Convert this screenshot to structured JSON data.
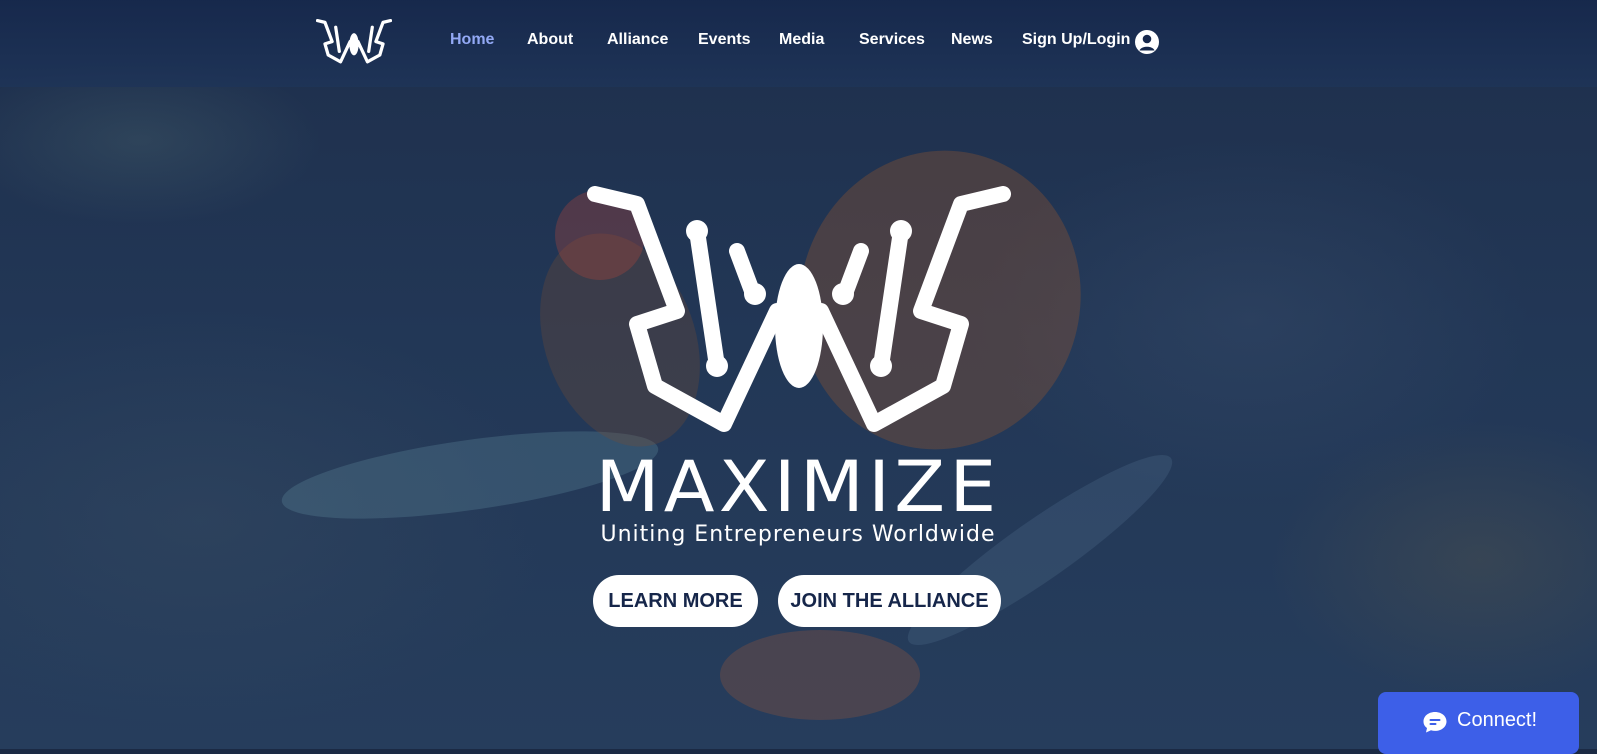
{
  "header": {
    "logo_icon": "butterfly-w-logo-icon",
    "nav": [
      {
        "label": "Home",
        "active": true
      },
      {
        "label": "About",
        "active": false
      },
      {
        "label": "Alliance",
        "active": false
      },
      {
        "label": "Events",
        "active": false
      },
      {
        "label": "Media",
        "active": false
      },
      {
        "label": "Services",
        "active": false
      },
      {
        "label": "News",
        "active": false
      }
    ],
    "login_label": "Sign Up/Login",
    "login_icon": "user-avatar-icon"
  },
  "hero": {
    "logo_icon": "butterfly-w-logo-icon",
    "brand_name": "MAXIMIZE",
    "tagline": "Uniting Entrepreneurs Worldwide",
    "learn_more_label": "LEARN MORE",
    "join_label": "JOIN THE ALLIANCE"
  },
  "chat": {
    "label": "Connect!",
    "icon": "chat-bubble-icon",
    "color": "#3d5fe8"
  },
  "colors": {
    "active_nav": "#93a9f5",
    "header_bg": "#16284c",
    "button_text": "#16264a"
  }
}
